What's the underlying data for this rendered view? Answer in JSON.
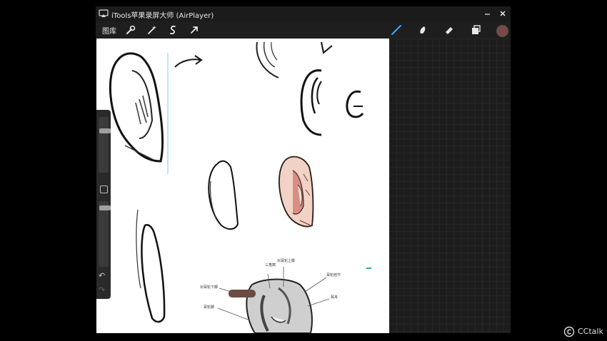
{
  "window": {
    "title": "iTools苹果录屏大师 (AirPlayer)",
    "minimize_icon": "minimize-icon",
    "close_icon": "close-icon"
  },
  "toolbar": {
    "gallery_label": "图库",
    "left_tools": [
      "wrench-icon",
      "magic-wand-icon",
      "selection-s-icon",
      "arrow-cursor-icon"
    ],
    "right_tools": [
      "brush-icon",
      "smudge-icon",
      "eraser-icon",
      "layers-icon"
    ],
    "color_swatch": "#7a4a45"
  },
  "canvas": {
    "annotations": [
      "三角窝",
      "对耳轮上脚",
      "耳轮结节",
      "对耳轮下脚",
      "耳舟",
      "耳轮脚"
    ]
  },
  "watermark": {
    "text": "CCtalk"
  }
}
